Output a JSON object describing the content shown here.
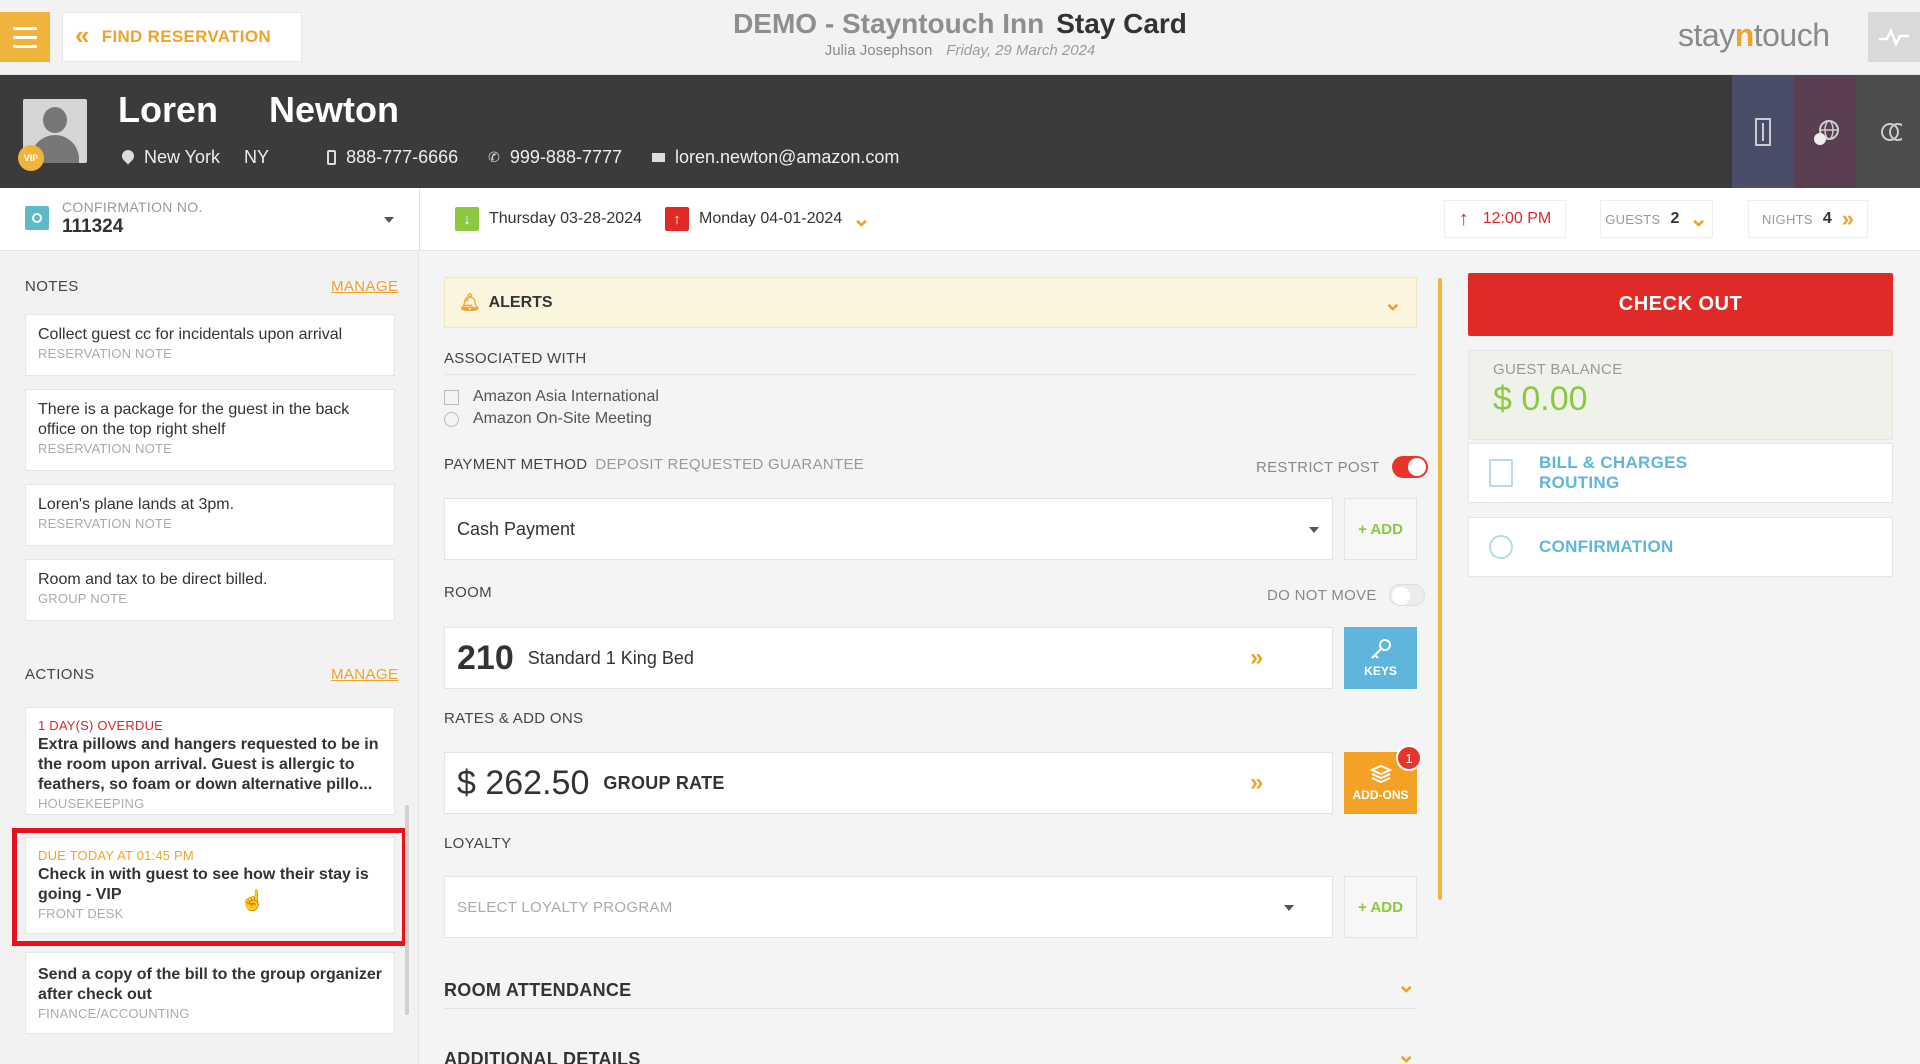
{
  "topbar": {
    "find_reservation": "FIND RESERVATION",
    "hotel": "DEMO - Stayntouch Inn",
    "page": "Stay Card",
    "user": "Julia Josephson",
    "date": "Friday, 29 March 2024",
    "logo_pre": "stay",
    "logo_n": "n",
    "logo_post": "touch"
  },
  "guest": {
    "first_name": "Loren",
    "last_name": "Newton",
    "vip": "VIP",
    "city": "New York",
    "state": "NY",
    "mobile": "888-777-6666",
    "phone": "999-888-7777",
    "email": "loren.newton@amazon.com"
  },
  "reservation": {
    "confirmation_label": "CONFIRMATION NO.",
    "confirmation_no": "111324",
    "arrival": "Thursday 03-28-2024",
    "departure": "Monday 04-01-2024",
    "departure_time": "12:00 PM",
    "guests_label": "GUESTS",
    "guests": "2",
    "nights_label": "NIGHTS",
    "nights": "4"
  },
  "notes": {
    "title": "NOTES",
    "manage": "MANAGE",
    "items": [
      {
        "text": "Collect guest cc for incidentals upon arrival",
        "type": "RESERVATION NOTE"
      },
      {
        "text": "There is a package for the guest in the back office on the top right shelf",
        "type": "RESERVATION NOTE"
      },
      {
        "text": "Loren's plane lands at 3pm.",
        "type": "RESERVATION NOTE"
      },
      {
        "text": "Room and tax to be direct billed.",
        "type": "GROUP NOTE"
      }
    ]
  },
  "actions": {
    "title": "ACTIONS",
    "manage": "MANAGE",
    "items": [
      {
        "status": "1 DAY(S) OVERDUE",
        "text": "Extra pillows and hangers requested to be in the room upon arrival. Guest is allergic to feathers, so foam or down alternative pillo...",
        "dept": "HOUSEKEEPING"
      },
      {
        "status": "DUE TODAY AT 01:45 PM",
        "text": "Check in with guest to see how their stay is going - VIP",
        "dept": "FRONT DESK"
      },
      {
        "status": "",
        "text": "Send a copy of the bill to the group organizer after check out",
        "dept": "FINANCE/ACCOUNTING"
      }
    ]
  },
  "main": {
    "alerts": "ALERTS",
    "associated_with": "ASSOCIATED WITH",
    "company": "Amazon Asia International",
    "group": "Amazon On-Site Meeting",
    "payment_method": "PAYMENT METHOD",
    "payment_sub": "DEPOSIT REQUESTED GUARANTEE",
    "restrict_post": "RESTRICT POST",
    "payment_value": "Cash Payment",
    "add": "+ ADD",
    "room_label": "ROOM",
    "do_not_move": "DO NOT MOVE",
    "room_no": "210",
    "room_type": "Standard 1 King Bed",
    "keys": "KEYS",
    "rates_label": "RATES & ADD ONS",
    "rate_value": "$ 262.50",
    "rate_name": "GROUP RATE",
    "addons": "ADD-ONS",
    "addons_count": "1",
    "loyalty_label": "LOYALTY",
    "loyalty_placeholder": "SELECT LOYALTY PROGRAM",
    "room_attendance": "ROOM ATTENDANCE",
    "additional_details": "ADDITIONAL DETAILS"
  },
  "right": {
    "checkout": "CHECK OUT",
    "balance_label": "GUEST BALANCE",
    "balance_value": "$ 0.00",
    "bill_line1": "BILL & CHARGES",
    "bill_line2": "ROUTING",
    "confirmation": "CONFIRMATION"
  },
  "colors": {
    "accent": "#f0a32a",
    "danger": "#e02a27",
    "positive": "#8dc63f",
    "info": "#5fb5db"
  }
}
